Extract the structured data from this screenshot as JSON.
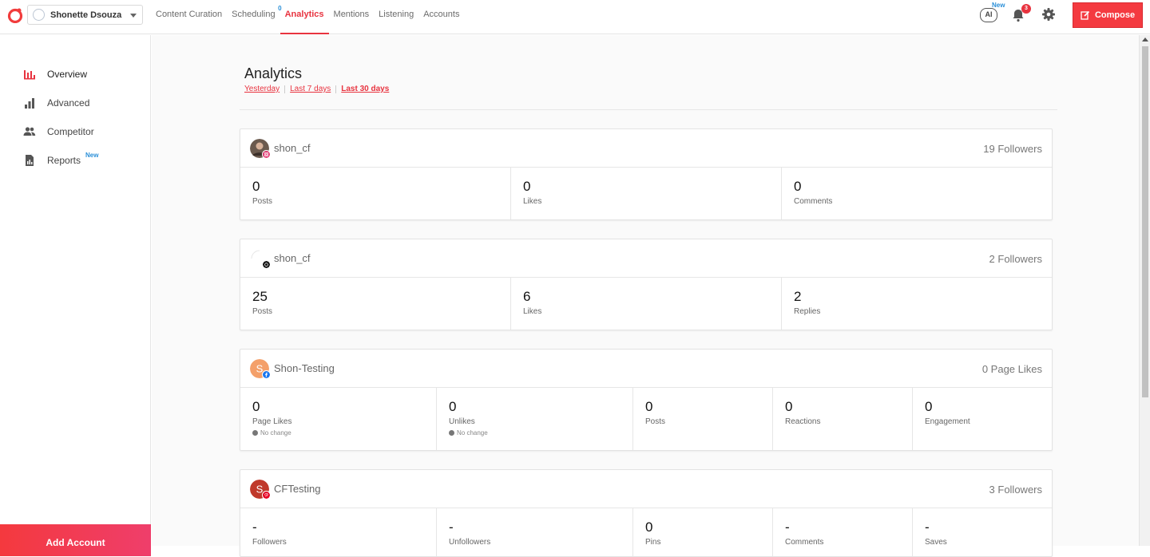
{
  "header": {
    "user_name": "Shonette Dsouza",
    "nav": [
      {
        "label": "Content Curation"
      },
      {
        "label": "Scheduling",
        "badge": "0"
      },
      {
        "label": "Analytics",
        "active": true
      },
      {
        "label": "Mentions"
      },
      {
        "label": "Listening"
      },
      {
        "label": "Accounts"
      }
    ],
    "ai_label": "AI",
    "ai_badge": "New",
    "notifications_count": "3",
    "compose_label": "Compose",
    "accent_color": "#f43a40"
  },
  "sidebar": {
    "items": [
      {
        "label": "Overview",
        "icon": "bar-chart-icon",
        "active": true
      },
      {
        "label": "Advanced",
        "icon": "signal-bars-icon"
      },
      {
        "label": "Competitor",
        "icon": "people-icon"
      },
      {
        "label": "Reports",
        "icon": "report-icon",
        "badge": "New"
      }
    ],
    "add_account_label": "Add Account"
  },
  "main": {
    "title": "Analytics",
    "ranges": [
      {
        "label": "Yesterday"
      },
      {
        "label": "Last 7 days"
      },
      {
        "label": "Last 30 days",
        "active": true
      }
    ],
    "cards": [
      {
        "network": "instagram",
        "name": "shon_cf",
        "count": "19 Followers",
        "stats": [
          {
            "value": "0",
            "label": "Posts"
          },
          {
            "value": "0",
            "label": "Likes"
          },
          {
            "value": "0",
            "label": "Comments"
          }
        ]
      },
      {
        "network": "threads",
        "name": "shon_cf",
        "count": "2 Followers",
        "stats": [
          {
            "value": "25",
            "label": "Posts"
          },
          {
            "value": "6",
            "label": "Likes"
          },
          {
            "value": "2",
            "label": "Replies"
          }
        ]
      },
      {
        "network": "facebook",
        "name": "Shon-Testing",
        "count": "0 Page Likes",
        "avatar_letter": "S",
        "stats": [
          {
            "value": "0",
            "label": "Page Likes",
            "change": "No change"
          },
          {
            "value": "0",
            "label": "Unlikes",
            "change": "No change"
          },
          {
            "value": "0",
            "label": "Posts"
          },
          {
            "value": "0",
            "label": "Reactions"
          },
          {
            "value": "0",
            "label": "Engagement"
          }
        ]
      },
      {
        "network": "pinterest",
        "name": "CFTesting",
        "count": "3 Followers",
        "avatar_letter": "S",
        "stats": [
          {
            "value": "-",
            "label": "Followers"
          },
          {
            "value": "-",
            "label": "Unfollowers"
          },
          {
            "value": "0",
            "label": "Pins"
          },
          {
            "value": "-",
            "label": "Comments"
          },
          {
            "value": "-",
            "label": "Saves"
          }
        ]
      }
    ]
  }
}
